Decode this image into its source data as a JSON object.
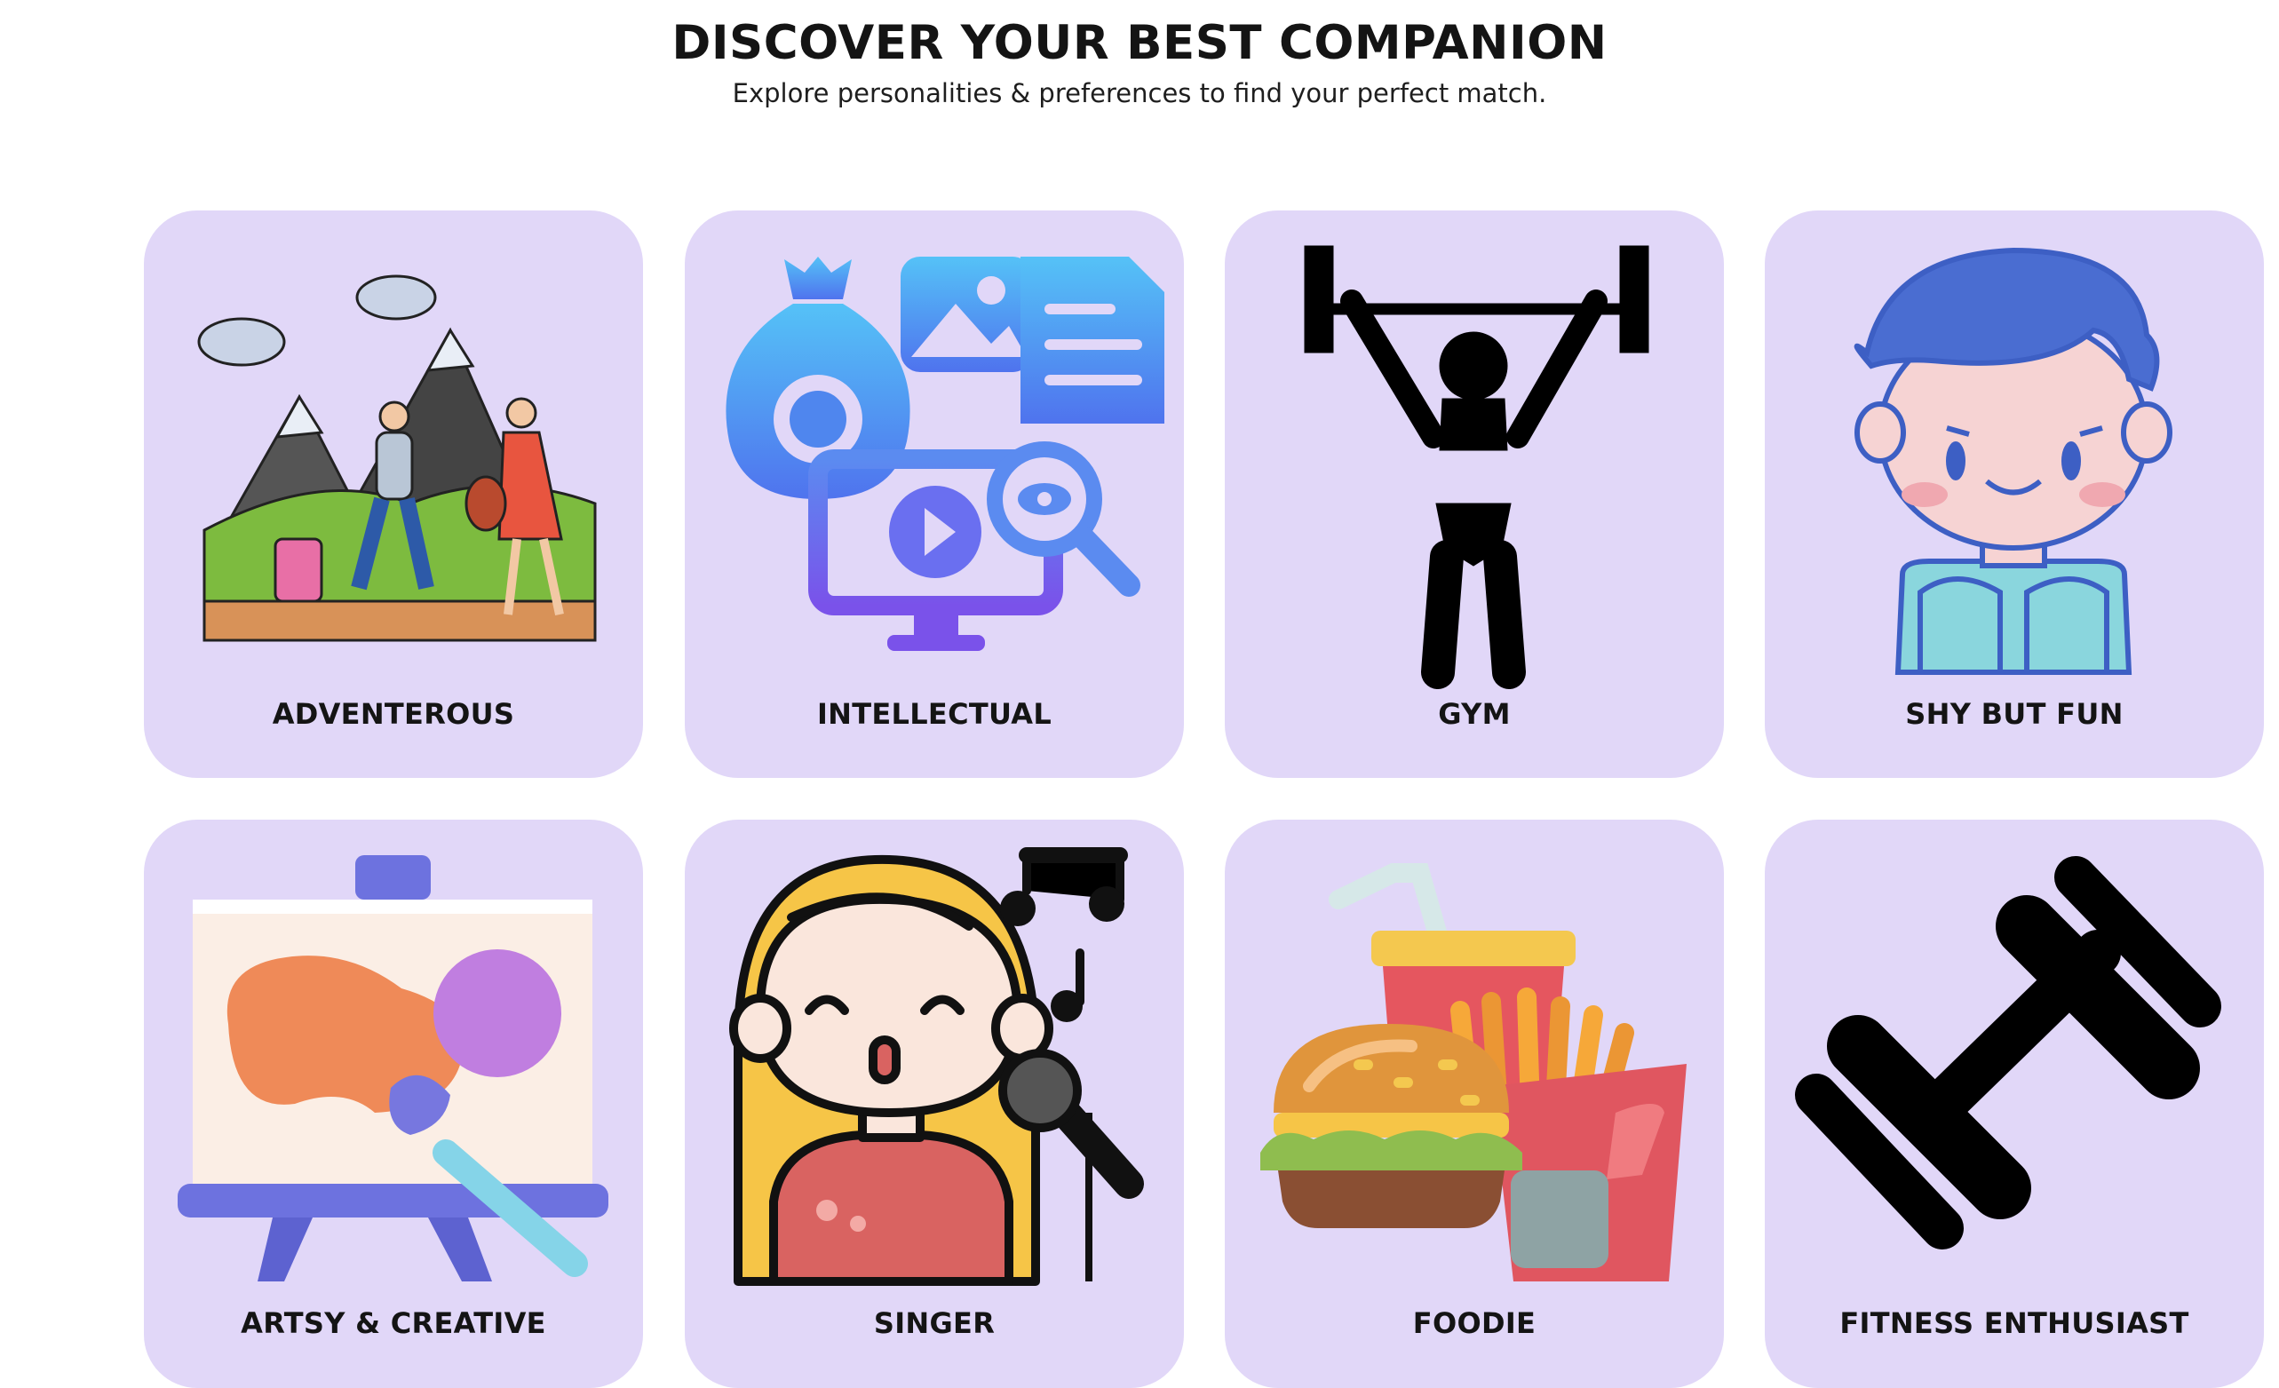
{
  "header": {
    "title": "DISCOVER YOUR BEST COMPANION",
    "subtitle": "Explore personalities & preferences to find your perfect match."
  },
  "cards": [
    {
      "label": "ADVENTEROUS",
      "icon": "hikers-mountains-icon"
    },
    {
      "label": "INTELLECTUAL",
      "icon": "knowledge-media-icon"
    },
    {
      "label": "GYM",
      "icon": "weightlifter-icon"
    },
    {
      "label": "SHY BUT FUN",
      "icon": "shy-boy-icon"
    },
    {
      "label": "ARTSY & CREATIVE",
      "icon": "easel-painting-icon"
    },
    {
      "label": "SINGER",
      "icon": "singer-microphone-icon"
    },
    {
      "label": "FOODIE",
      "icon": "burger-fries-icon"
    },
    {
      "label": "FITNESS ENTHUSIAST",
      "icon": "dumbbell-icon"
    }
  ],
  "colors": {
    "card_background": "#e1d7f8",
    "text": "#141414"
  }
}
